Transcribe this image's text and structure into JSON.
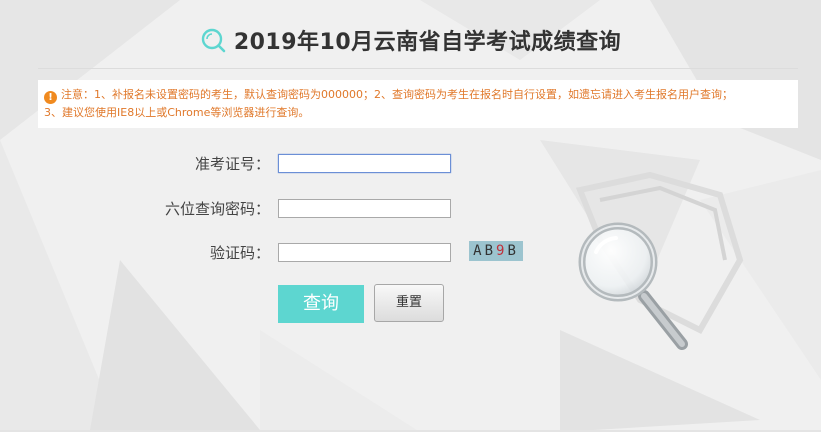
{
  "header": {
    "title": "2019年10月云南省自学考试成绩查询",
    "logo_icon": "search-icon"
  },
  "notice": {
    "icon": "warning-icon",
    "text_line1": "注意：1、补报名未设置密码的考生，默认查询密码为000000；2、查询密码为考生在报名时自行设置，如遗忘请进入考生报名用户查询；",
    "text_line2": "3、建议您使用IE8以上或Chrome等浏览器进行查询。"
  },
  "form": {
    "exam_id_label": "准考证号：",
    "exam_id_value": "",
    "password_label": "六位查询密码：",
    "password_value": "",
    "captcha_label": "验证码：",
    "captcha_value": "",
    "captcha_chars": [
      "A",
      "B",
      "9",
      "B"
    ]
  },
  "buttons": {
    "query_label": "查询",
    "reset_label": "重置"
  },
  "colors": {
    "accent": "#5dd6d0",
    "notice_text": "#e0782a",
    "warning_icon": "#f08a1f",
    "captcha_bg": "#9cc4cf",
    "captcha_highlight": "#c0303a"
  }
}
